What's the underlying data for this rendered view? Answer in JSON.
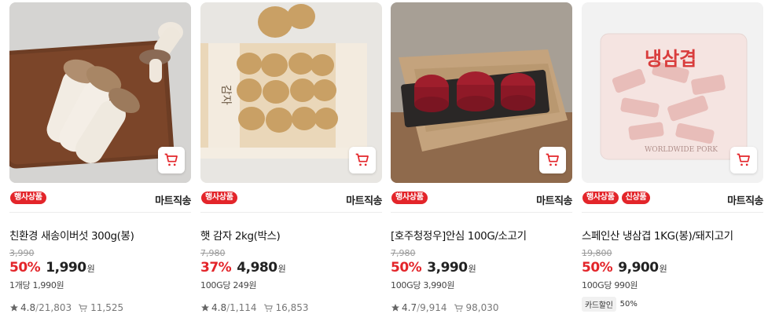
{
  "products": [
    {
      "badges": [
        "행사상품"
      ],
      "shipping": "마트직송",
      "name": "친환경 새송이버섯 300g(봉)",
      "original_price": "3,990",
      "discount": "50%",
      "price": "1,990",
      "currency": "원",
      "unit_price": "1개당 1,990원",
      "rating": "4.8",
      "reviews": "21,803",
      "cart_count": "11,525"
    },
    {
      "badges": [
        "행사상품"
      ],
      "shipping": "마트직송",
      "name": "햇 감자 2kg(박스)",
      "original_price": "7,980",
      "discount": "37%",
      "price": "4,980",
      "currency": "원",
      "unit_price": "100G당 249원",
      "rating": "4.8",
      "reviews": "1,114",
      "cart_count": "16,853"
    },
    {
      "badges": [
        "행사상품"
      ],
      "shipping": "마트직송",
      "name": "[호주청정우]안심 100G/소고기",
      "original_price": "7,980",
      "discount": "50%",
      "price": "3,990",
      "currency": "원",
      "unit_price": "100G당 3,990원",
      "rating": "4.7",
      "reviews": "9,914",
      "cart_count": "98,030"
    },
    {
      "badges": [
        "행사상품",
        "신상품"
      ],
      "shipping": "마트직송",
      "name": "스페인산 냉삼겹 1KG(봉)/돼지고기",
      "original_price": "19,800",
      "discount": "50%",
      "price": "9,900",
      "currency": "원",
      "unit_price": "100G당 990원",
      "card_discount_label": "카드할인",
      "card_discount_value": "50%",
      "package_text": "냉삼겹",
      "package_subtext": "WORLDWIDE PORK",
      "potato_box_text": "감자"
    }
  ],
  "icons": {
    "cart": "cart-icon",
    "star": "star-icon",
    "cart_count": "cart-count-icon"
  },
  "colors": {
    "accent": "#e3252a"
  }
}
